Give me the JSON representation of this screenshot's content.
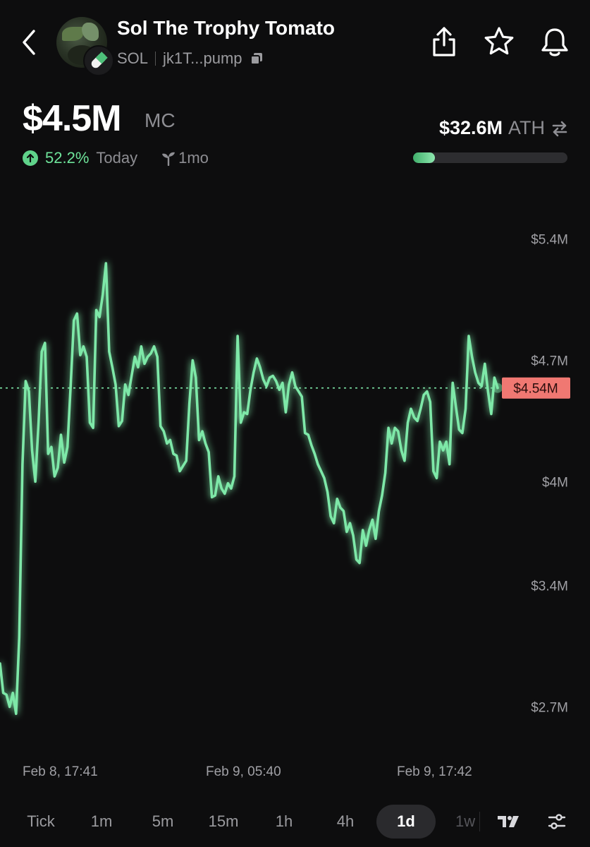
{
  "header": {
    "token_name": "Sol The Trophy Tomato",
    "chain": "SOL",
    "address": "jk1T...pump"
  },
  "stats": {
    "market_cap": "$4.5M",
    "mc_label": "MC",
    "change_pct": "52.2%",
    "change_period": "Today",
    "age": "1mo",
    "ath_value": "$32.6M",
    "ath_label": "ATH",
    "ath_progress_fraction": 0.14
  },
  "chart_data": {
    "type": "line",
    "series_color": "#7ee8a8",
    "y_tick_labels": [
      "$5.4M",
      "$4.7M",
      "$4M",
      "$3.4M",
      "$2.7M"
    ],
    "current_price_label": "$4.54M",
    "current_price_value": 4.54,
    "x_tick_labels": [
      "Feb 8, 17:41",
      "Feb 9, 05:40",
      "Feb 9, 17:42"
    ],
    "values": [
      2.95,
      2.78,
      2.77,
      2.7,
      2.78,
      2.66,
      3.1,
      4.1,
      4.58,
      4.52,
      4.18,
      4.0,
      4.34,
      4.75,
      4.8,
      4.16,
      4.2,
      4.03,
      4.08,
      4.27,
      4.11,
      4.2,
      4.55,
      4.93,
      4.97,
      4.73,
      4.78,
      4.72,
      4.34,
      4.31,
      4.99,
      4.95,
      5.08,
      5.26,
      4.75,
      4.66,
      4.56,
      4.32,
      4.35,
      4.56,
      4.5,
      4.61,
      4.72,
      4.66,
      4.78,
      4.68,
      4.72,
      4.74,
      4.78,
      4.72,
      4.32,
      4.29,
      4.22,
      4.24,
      4.16,
      4.15,
      4.06,
      4.09,
      4.12,
      4.45,
      4.7,
      4.6,
      4.24,
      4.29,
      4.22,
      4.17,
      3.91,
      3.92,
      4.03,
      3.96,
      3.93,
      3.99,
      3.96,
      4.03,
      4.84,
      4.34,
      4.4,
      4.39,
      4.53,
      4.63,
      4.71,
      4.66,
      4.59,
      4.55,
      4.6,
      4.61,
      4.58,
      4.53,
      4.57,
      4.4,
      4.56,
      4.63,
      4.55,
      4.52,
      4.49,
      4.28,
      4.27,
      4.21,
      4.16,
      4.1,
      4.06,
      4.02,
      3.94,
      3.8,
      3.76,
      3.9,
      3.85,
      3.83,
      3.71,
      3.76,
      3.69,
      3.55,
      3.53,
      3.72,
      3.63,
      3.72,
      3.78,
      3.67,
      3.83,
      3.92,
      4.05,
      4.31,
      4.22,
      4.31,
      4.29,
      4.18,
      4.12,
      4.34,
      4.42,
      4.37,
      4.35,
      4.42,
      4.5,
      4.52,
      4.46,
      4.06,
      4.02,
      4.23,
      4.18,
      4.23,
      4.1,
      4.57,
      4.43,
      4.3,
      4.28,
      4.42,
      4.84,
      4.72,
      4.63,
      4.57,
      4.55,
      4.68,
      4.52,
      4.39,
      4.6,
      4.54
    ],
    "y_range": [
      2.4,
      5.7
    ],
    "grid": false,
    "legend": false
  },
  "timeframes": {
    "items": [
      {
        "label": "Tick"
      },
      {
        "label": "1m"
      },
      {
        "label": "5m"
      },
      {
        "label": "15m"
      },
      {
        "label": "1h"
      },
      {
        "label": "4h"
      },
      {
        "label": "1d"
      },
      {
        "label": "1w"
      }
    ],
    "active": "1d"
  },
  "icons": [
    "back-arrow-icon",
    "pill-icon",
    "copy-icon",
    "share-icon",
    "star-icon",
    "bell-icon",
    "arrow-up-circle-icon",
    "sprout-icon",
    "swap-arrows-icon",
    "tradingview-icon",
    "filter-sliders-icon"
  ]
}
